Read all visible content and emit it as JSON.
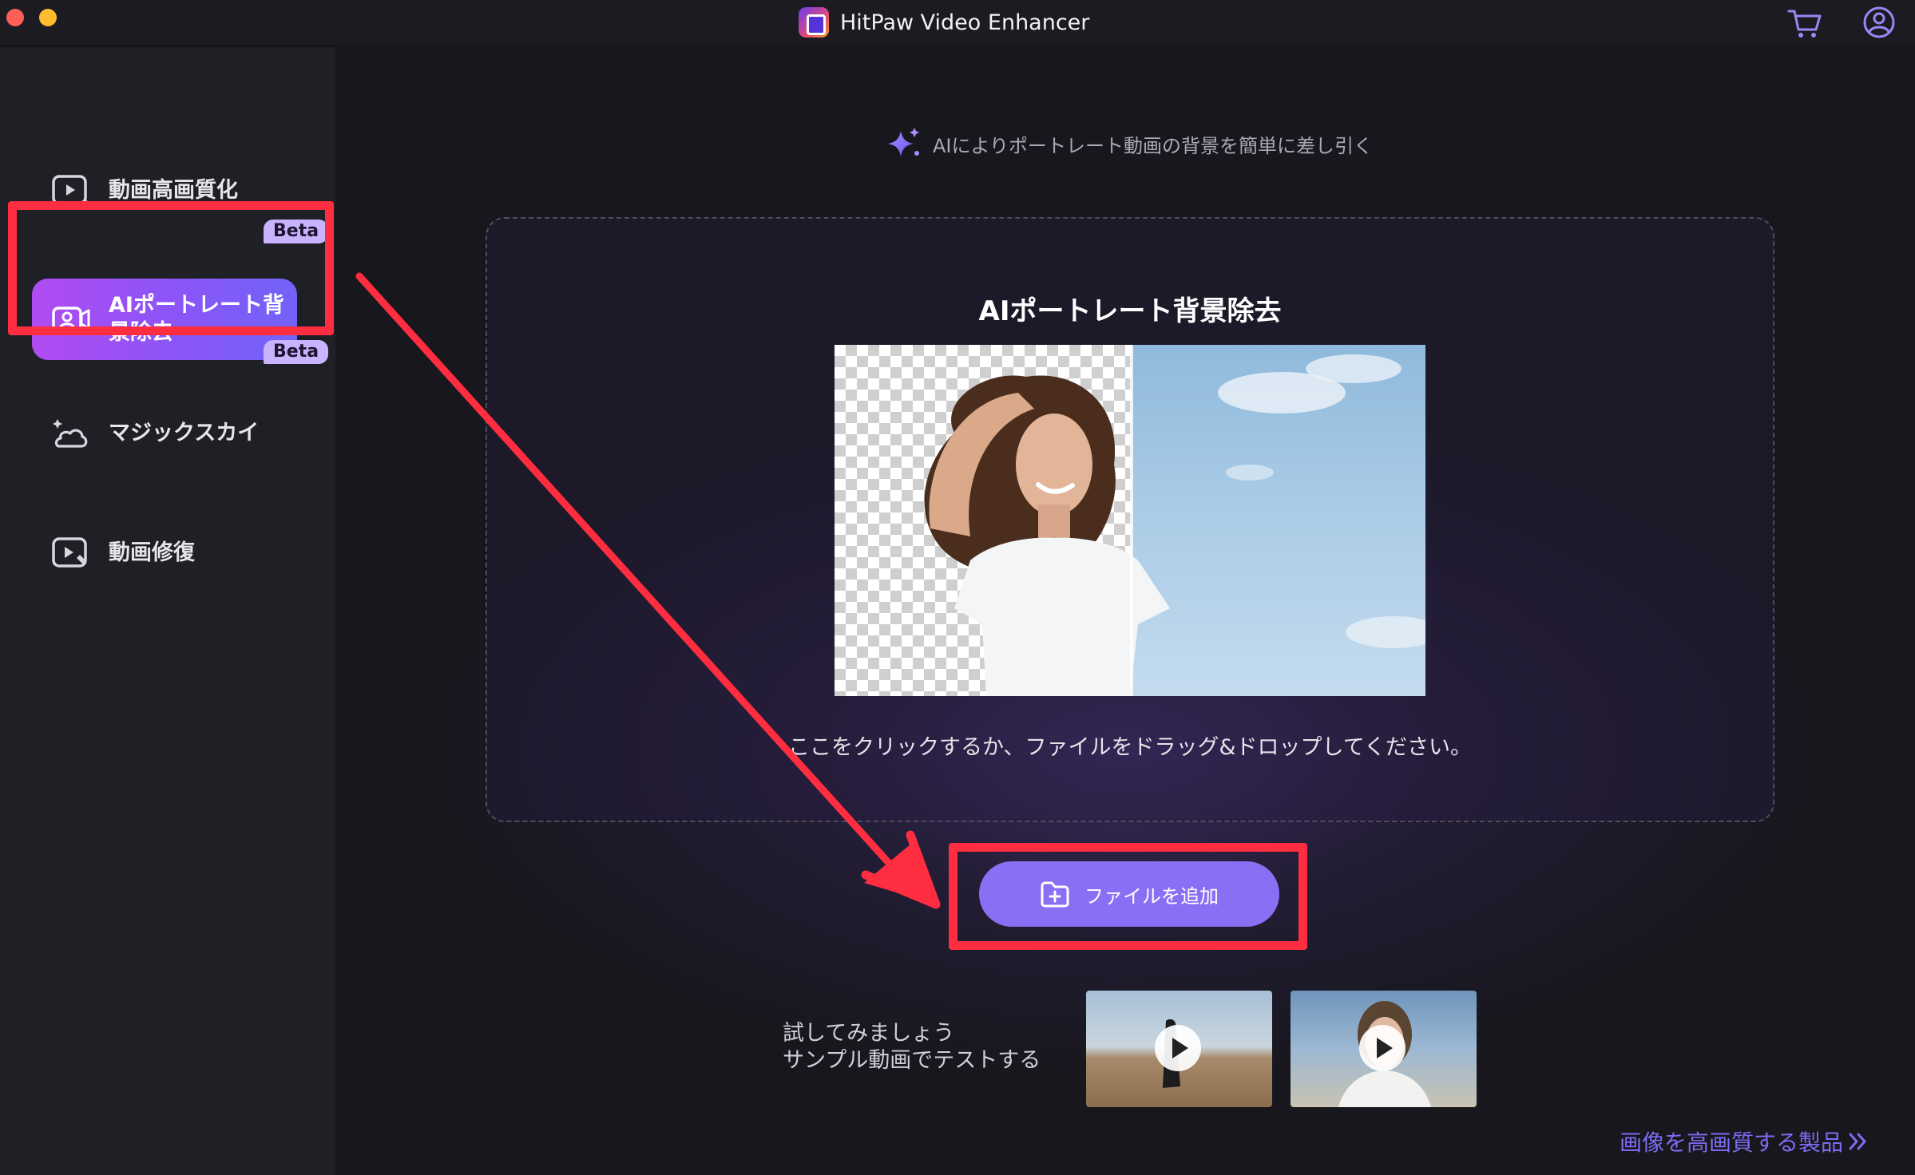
{
  "window": {
    "title": "HitPaw Video Enhancer"
  },
  "sidebar": {
    "items": [
      {
        "label": "動画高画質化",
        "icon": "video-enhance-icon"
      },
      {
        "label": "AIポートレート背景除去",
        "icon": "portrait-camera-icon",
        "badge": "Beta",
        "active": true
      },
      {
        "label": "マジックスカイ",
        "icon": "magic-sky-icon",
        "badge": "Beta"
      },
      {
        "label": "動画修復",
        "icon": "video-repair-icon"
      }
    ]
  },
  "main": {
    "subtitle": "AIによりポートレート動画の背景を簡単に差し引く",
    "dropzone": {
      "title": "AIポートレート背景除去",
      "hint": "ここをクリックするか、ファイルをドラッグ&ドロップしてください。"
    },
    "add_button": "ファイルを追加",
    "try_line1": "試してみましょう",
    "try_line2": "サンプル動画でテストする",
    "more_link": "画像を高画質する製品"
  },
  "colors": {
    "highlight": "#fe2d3f",
    "accent": "#8a6ff4",
    "active_gradient_start": "#b04bf2",
    "beta_badge": "#c9b3ff"
  }
}
